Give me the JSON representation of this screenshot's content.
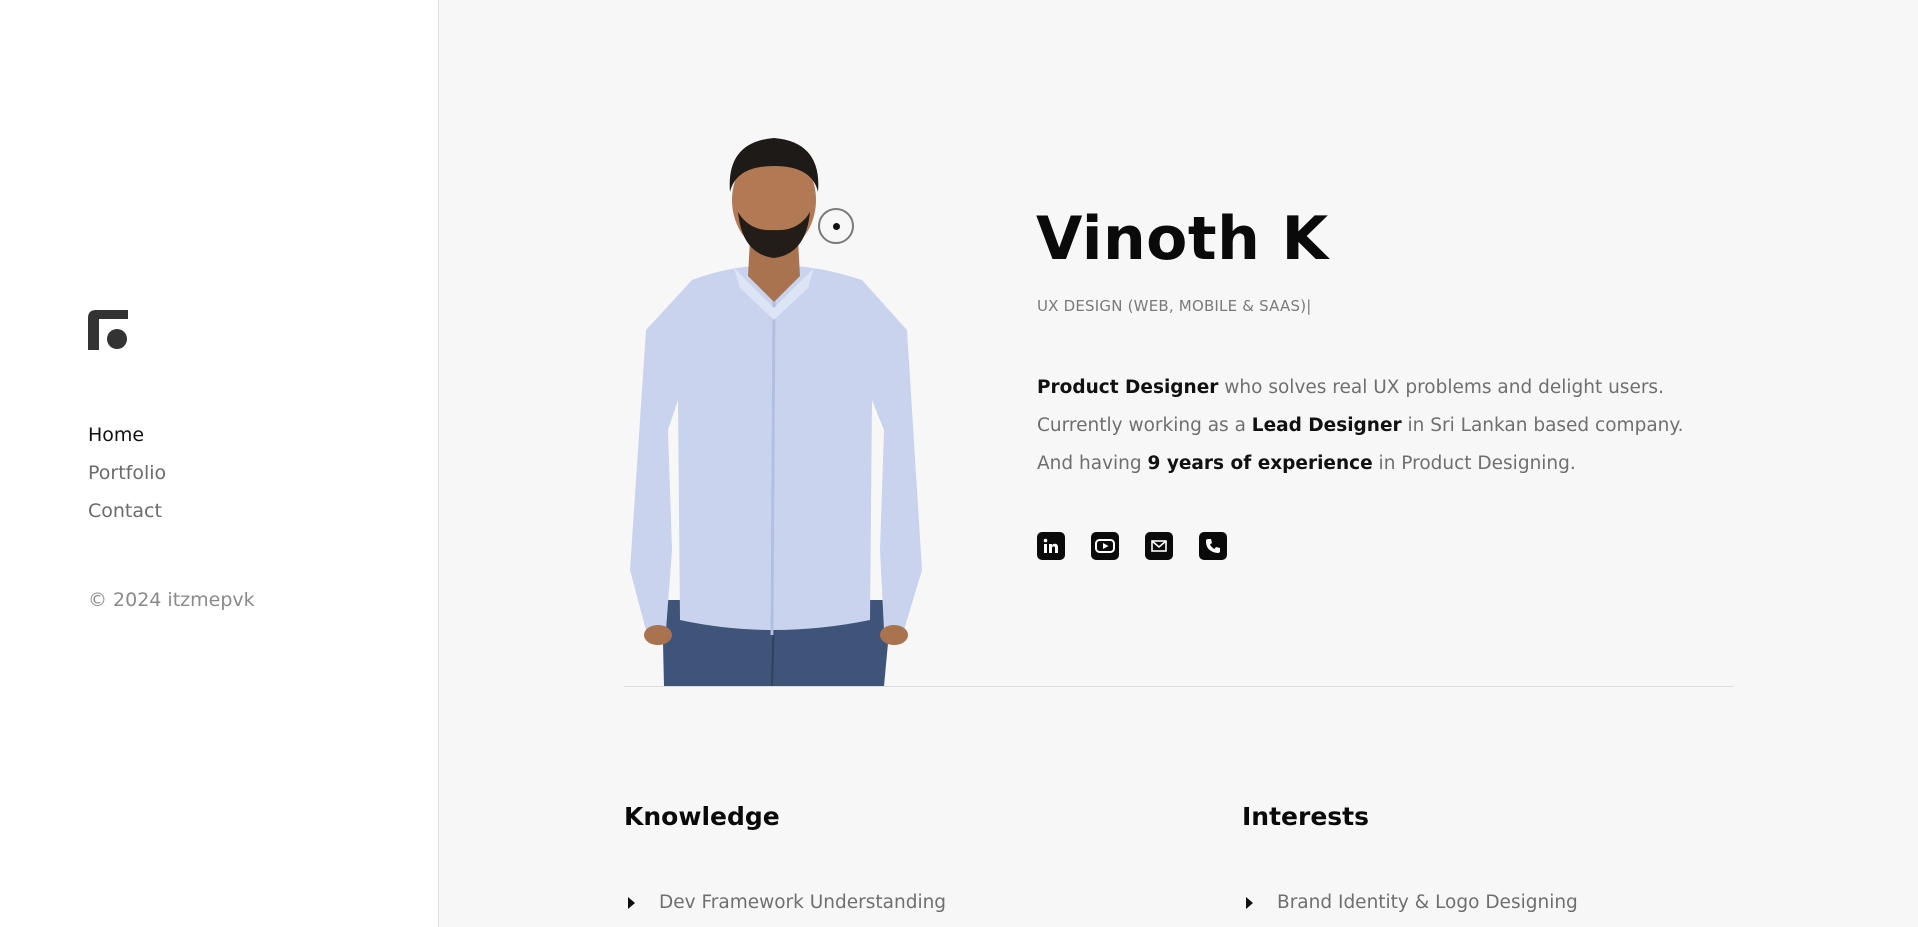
{
  "sidebar": {
    "logo_icon": "brand-logo-icon",
    "nav": [
      {
        "label": "Home",
        "active": true
      },
      {
        "label": "Portfolio",
        "active": false
      },
      {
        "label": "Contact",
        "active": false
      }
    ],
    "copyright": "© 2024 itzmepvk"
  },
  "profile": {
    "name": "Vinoth K",
    "role": "UX DESIGN (WEB, MOBILE & SAAS)|",
    "bio": {
      "line1": {
        "strong": "Product Designer",
        "rest": " who solves real UX problems and delight users."
      },
      "line2": {
        "pre": "Currently working as a ",
        "strong": "Lead Designer",
        "rest": " in Sri Lankan based company."
      },
      "line3": {
        "pre": "And having ",
        "strong": "9 years of experience",
        "rest": " in Product Designing."
      }
    },
    "socials": [
      "linkedin-icon",
      "youtube-icon",
      "email-icon",
      "phone-icon"
    ]
  },
  "knowledge": {
    "title": "Knowledge",
    "items": [
      "Dev Framework Understanding"
    ]
  },
  "interests": {
    "title": "Interests",
    "items": [
      "Brand Identity & Logo Designing"
    ]
  },
  "colors": {
    "background": "#f7f7f7",
    "sidebar": "#ffffff",
    "text_dark": "#0a0a0a",
    "text_muted": "#6f6f6f",
    "shirt": "#c9d3ee",
    "pants": "#3f5479"
  }
}
